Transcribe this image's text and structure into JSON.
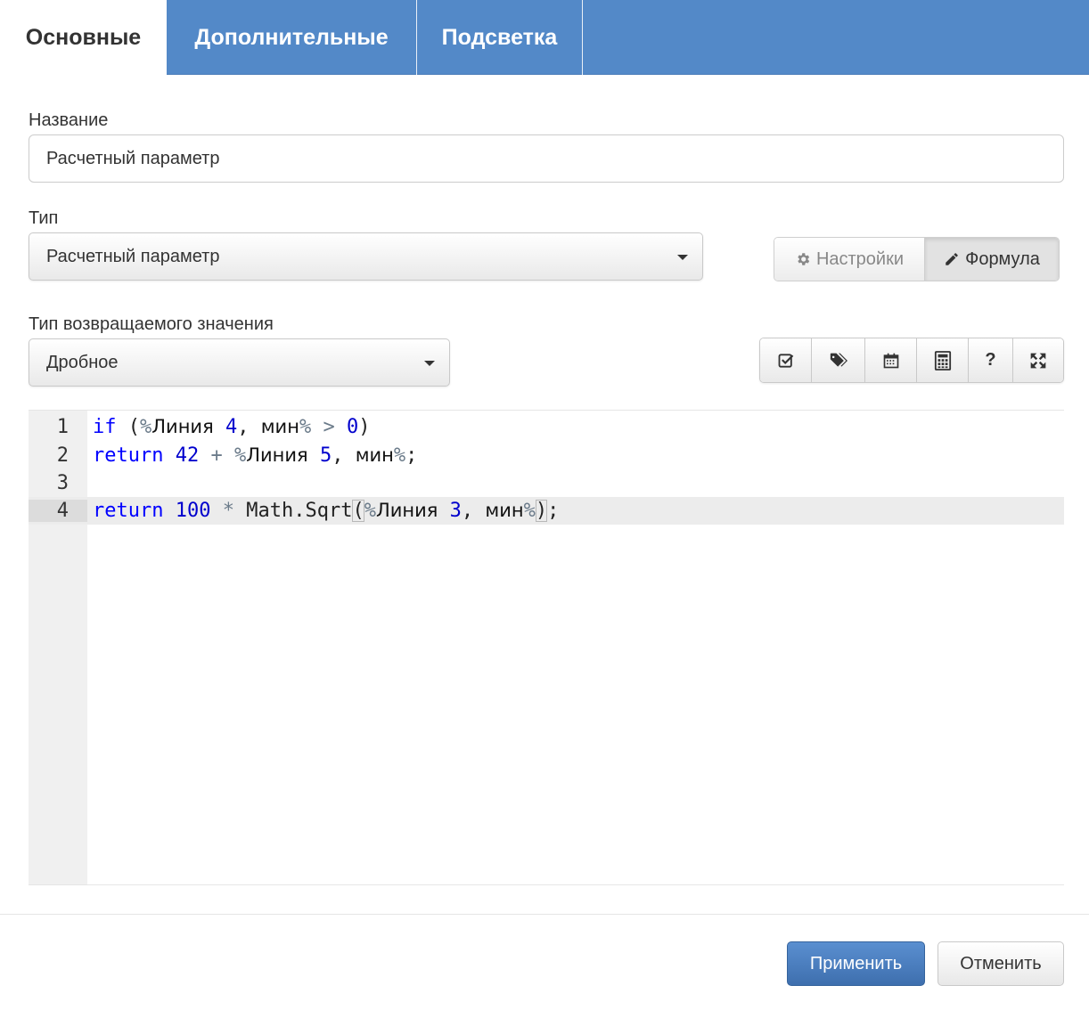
{
  "tabs": [
    {
      "label": "Основные",
      "active": true
    },
    {
      "label": "Дополнительные",
      "active": false
    },
    {
      "label": "Подсветка",
      "active": false
    }
  ],
  "form": {
    "name_label": "Название",
    "name_value": "Расчетный параметр",
    "type_label": "Тип",
    "type_value": "Расчетный параметр",
    "return_type_label": "Тип возвращаемого значения",
    "return_type_value": "Дробное"
  },
  "mode_toggle": {
    "settings_label": "Настройки",
    "formula_label": "Формула",
    "selected": "Формула"
  },
  "toolbar": {
    "icons": [
      "check-square-icon",
      "tags-icon",
      "calendar-icon",
      "calculator-icon",
      "question-icon",
      "expand-icon"
    ]
  },
  "editor": {
    "line_numbers": [
      "1",
      "2",
      "3",
      "4"
    ],
    "lines": [
      "if (%Линия 4, мин% > 0)",
      "return 42 + %Линия 5, мин%;",
      "",
      "return 100 * Math.Sqrt(%Линия 3, мин%);"
    ],
    "active_line": 4
  },
  "footer": {
    "apply_label": "Применить",
    "cancel_label": "Отменить"
  },
  "colors": {
    "tab_bar": "#5389c8",
    "primary_button": "#4a7dbf",
    "keyword": "#0000ff",
    "number": "#0000cd"
  }
}
